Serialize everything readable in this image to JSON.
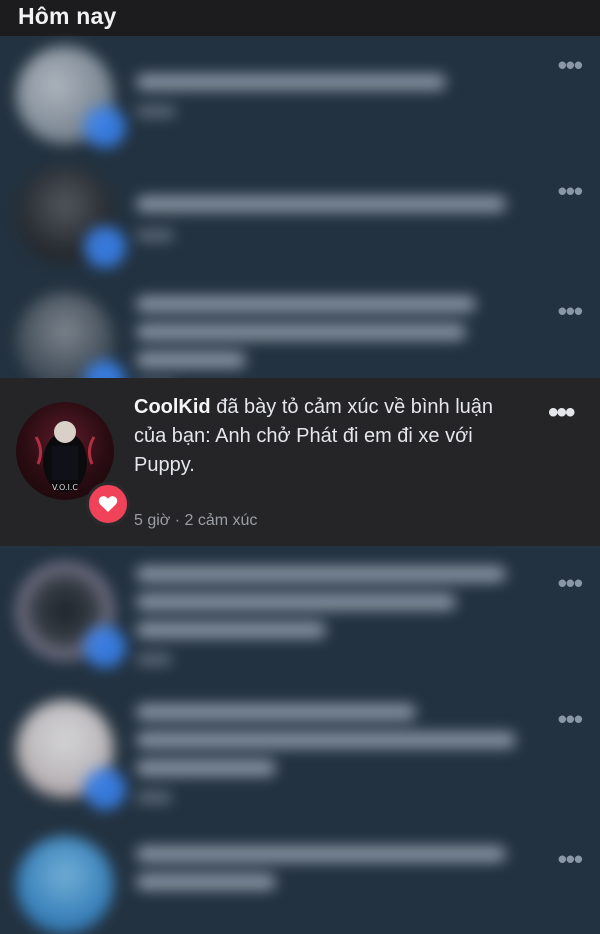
{
  "header": {
    "title": "Hôm nay"
  },
  "highlighted": {
    "user": "CoolKid",
    "message": " đã bày tỏ cảm xúc về bình luận của bạn: Anh chở Phát đi em đi xe với Puppy.",
    "time": "5 giờ",
    "separator": " · ",
    "reactions": "2 cảm xúc",
    "more": "•••",
    "badge_icon": "heart-icon",
    "avatar_text": "V.O.I.C"
  },
  "blurred": {
    "more": "•••"
  },
  "colors": {
    "background": "#233240",
    "highlight": "#252527",
    "like_badge": "#3a86f5",
    "love_badge": "#f0435a"
  }
}
